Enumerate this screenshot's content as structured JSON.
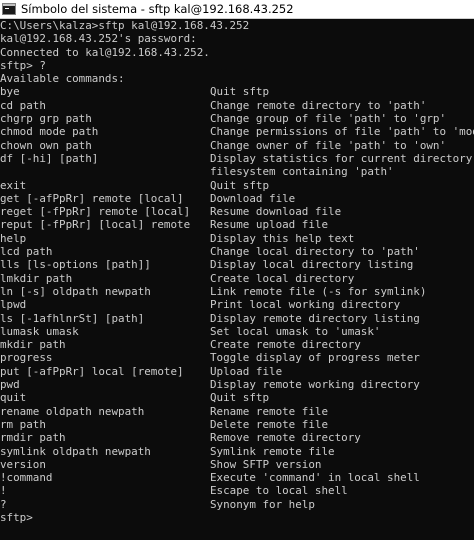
{
  "window": {
    "title": "Símbolo del sistema - sftp  kal@192.168.43.252",
    "icon": "cmd-icon"
  },
  "session": {
    "intro_lines": [
      "C:\\Users\\kalza>sftp kal@192.168.43.252",
      "kal@192.168.43.252's password:",
      "Connected to kal@192.168.43.252.",
      "sftp> ?",
      "Available commands:"
    ],
    "commands": [
      {
        "cmd": "bye",
        "desc": "Quit sftp"
      },
      {
        "cmd": "cd path",
        "desc": "Change remote directory to 'path'"
      },
      {
        "cmd": "chgrp grp path",
        "desc": "Change group of file 'path' to 'grp'"
      },
      {
        "cmd": "chmod mode path",
        "desc": "Change permissions of file 'path' to 'mode'"
      },
      {
        "cmd": "chown own path",
        "desc": "Change owner of file 'path' to 'own'"
      },
      {
        "cmd": "df [-hi] [path]",
        "desc": "Display statistics for current directory or"
      },
      {
        "cmd": "",
        "desc": "filesystem containing 'path'"
      },
      {
        "cmd": "exit",
        "desc": "Quit sftp"
      },
      {
        "cmd": "get [-afPpRr] remote [local]",
        "desc": "Download file"
      },
      {
        "cmd": "reget [-fPpRr] remote [local]",
        "desc": "Resume download file"
      },
      {
        "cmd": "reput [-fPpRr] [local] remote",
        "desc": "Resume upload file"
      },
      {
        "cmd": "help",
        "desc": "Display this help text"
      },
      {
        "cmd": "lcd path",
        "desc": "Change local directory to 'path'"
      },
      {
        "cmd": "lls [ls-options [path]]",
        "desc": "Display local directory listing"
      },
      {
        "cmd": "lmkdir path",
        "desc": "Create local directory"
      },
      {
        "cmd": "ln [-s] oldpath newpath",
        "desc": "Link remote file (-s for symlink)"
      },
      {
        "cmd": "lpwd",
        "desc": "Print local working directory"
      },
      {
        "cmd": "ls [-1afhlnrSt] [path]",
        "desc": "Display remote directory listing"
      },
      {
        "cmd": "lumask umask",
        "desc": "Set local umask to 'umask'"
      },
      {
        "cmd": "mkdir path",
        "desc": "Create remote directory"
      },
      {
        "cmd": "progress",
        "desc": "Toggle display of progress meter"
      },
      {
        "cmd": "put [-afPpRr] local [remote]",
        "desc": "Upload file"
      },
      {
        "cmd": "pwd",
        "desc": "Display remote working directory"
      },
      {
        "cmd": "quit",
        "desc": "Quit sftp"
      },
      {
        "cmd": "rename oldpath newpath",
        "desc": "Rename remote file"
      },
      {
        "cmd": "rm path",
        "desc": "Delete remote file"
      },
      {
        "cmd": "rmdir path",
        "desc": "Remove remote directory"
      },
      {
        "cmd": "symlink oldpath newpath",
        "desc": "Symlink remote file"
      },
      {
        "cmd": "version",
        "desc": "Show SFTP version"
      },
      {
        "cmd": "!command",
        "desc": "Execute 'command' in local shell"
      },
      {
        "cmd": "!",
        "desc": "Escape to local shell"
      },
      {
        "cmd": "?",
        "desc": "Synonym for help"
      }
    ],
    "prompt": "sftp>"
  },
  "colors": {
    "background": "#0c0c0c",
    "text": "#cccccc",
    "titlebar": "#ffffff"
  }
}
